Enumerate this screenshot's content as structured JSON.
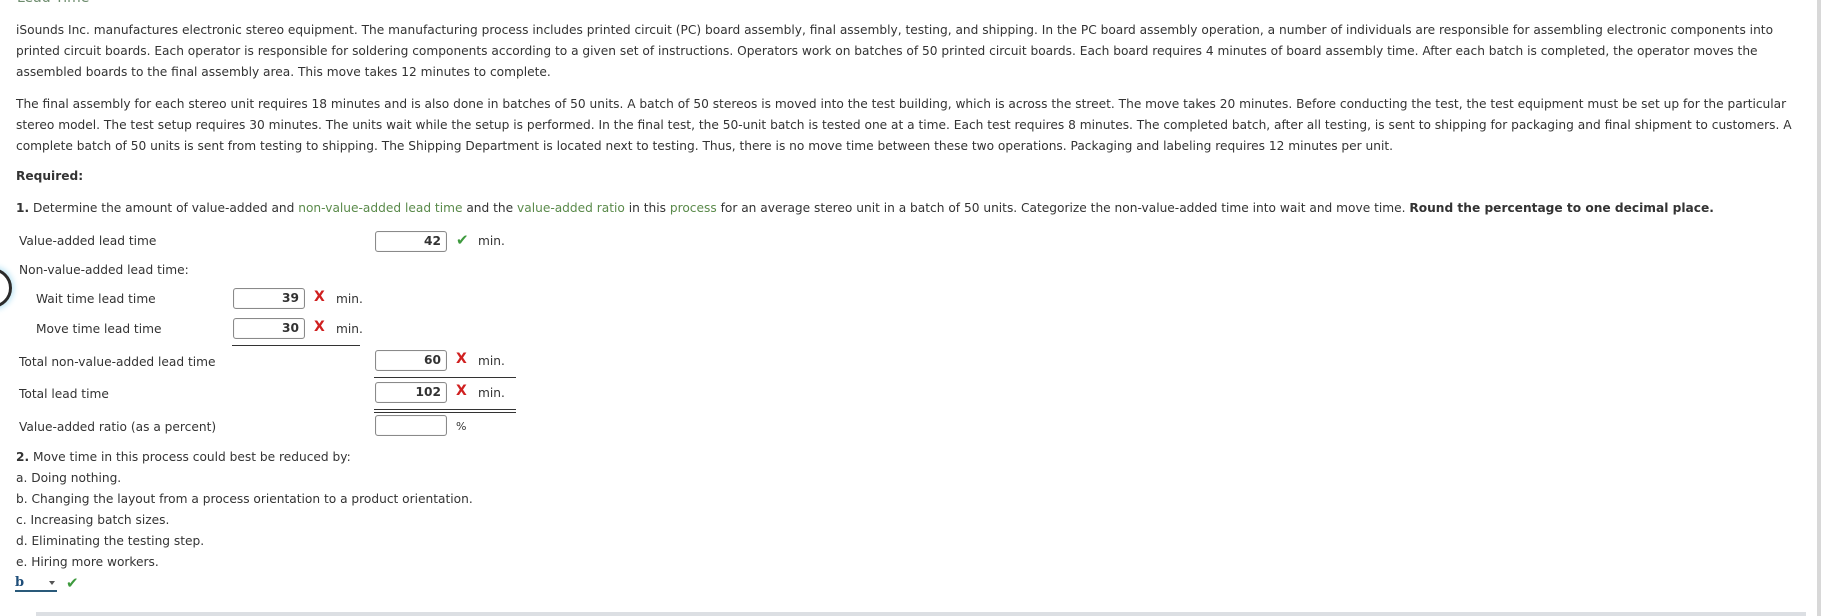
{
  "section_title": "Lead Time",
  "problem": {
    "paragraph1": "iSounds Inc. manufactures electronic stereo equipment. The manufacturing process includes printed circuit (PC) board assembly, final assembly, testing, and shipping. In the PC board assembly operation, a number of individuals are responsible for assembling electronic components into printed circuit boards. Each operator is responsible for soldering components according to a given set of instructions. Operators work on batches of 50 printed circuit boards. Each board requires 4 minutes of board assembly time. After each batch is completed, the operator moves the assembled boards to the final assembly area. This move takes 12 minutes to complete.",
    "paragraph2": "The final assembly for each stereo unit requires 18 minutes and is also done in batches of 50 units. A batch of 50 stereos is moved into the test building, which is across the street. The move takes 20 minutes. Before conducting the test, the test equipment must be set up for the particular stereo model. The test setup requires 30 minutes. The units wait while the setup is performed. In the final test, the 50-unit batch is tested one at a time. Each test requires 8 minutes. The completed batch, after all testing, is sent to shipping for packaging and final shipment to customers. A complete batch of 50 units is sent from testing to shipping. The Shipping Department is located next to testing. Thus, there is no move time between these two operations. Packaging and labeling requires 12 minutes per unit."
  },
  "required_label": "Required:",
  "q1": {
    "number": "1.",
    "text_a": " Determine the amount of value-added and ",
    "link1": "non-value-added lead time",
    "text_b": " and the ",
    "link2": "value-added ratio",
    "text_c": " in this ",
    "link3": "process",
    "text_d": " for an average stereo unit in a batch of 50 units. Categorize the non-value-added time into wait and move time. ",
    "bold": "Round the percentage to one decimal place.",
    "rows": {
      "value_added": {
        "label": "Value-added lead time",
        "value": "42",
        "status": "correct",
        "unit": "min."
      },
      "nva_heading": "Non-value-added lead time:",
      "wait": {
        "label": "Wait time lead time",
        "value": "39",
        "status": "incorrect",
        "unit": "min."
      },
      "move": {
        "label": "Move time lead time",
        "value": "30",
        "status": "incorrect",
        "unit": "min."
      },
      "total_nva": {
        "label": "Total non-value-added lead time",
        "value": "60",
        "status": "incorrect",
        "unit": "min."
      },
      "total": {
        "label": "Total lead time",
        "value": "102",
        "status": "incorrect",
        "unit": "min."
      },
      "ratio": {
        "label": "Value-added ratio (as a percent)",
        "value": "",
        "unit": "%"
      }
    },
    "marks": {
      "correct": "✔",
      "incorrect": "X"
    }
  },
  "q2": {
    "number": "2.",
    "text": " Move time in this process could best be reduced by:",
    "options": [
      "a. Doing nothing.",
      "b. Changing the layout from a process orientation to a product orientation.",
      "c. Increasing batch sizes.",
      "d. Eliminating the testing step.",
      "e. Hiring more workers."
    ],
    "selected": "b",
    "status": "correct"
  }
}
